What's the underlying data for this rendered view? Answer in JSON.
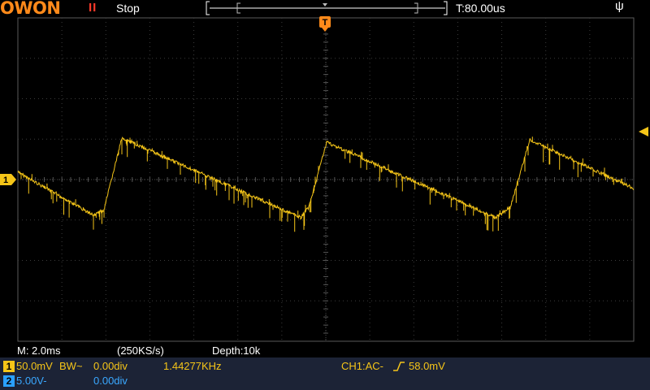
{
  "header": {
    "brand": "OWON",
    "run_state_icon": "pause-icon",
    "status": "Stop",
    "trigger_delay": "T:80.00us",
    "usb_icon": "usb-icon"
  },
  "screen": {
    "trigger_marker": "T",
    "ch1_marker": "1",
    "colors": {
      "ch1": "#f5c518",
      "ch2": "#2aa0ff",
      "accent": "#ff8a1a",
      "grid": "#4a4a4a"
    }
  },
  "info": {
    "timebase": "M: 2.0ms",
    "sample_rate": "(250KS/s)",
    "depth": "Depth:10k"
  },
  "ch1": {
    "badge": "1",
    "scale": "50.0mV",
    "coupling": "BW~",
    "offset": "0.00div",
    "frequency": "1.44277KHz",
    "trigger": "CH1:AC-",
    "trigger_icon": "rising-edge-icon",
    "trigger_level": "58.0mV"
  },
  "ch2": {
    "badge": "2",
    "scale": "5.00V-",
    "offset": "0.00div"
  }
}
